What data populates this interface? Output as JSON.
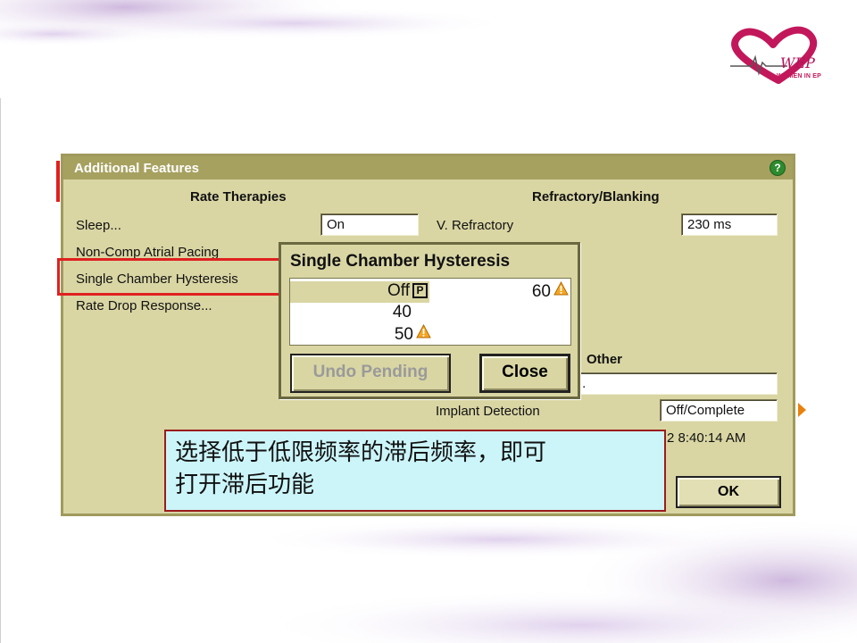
{
  "logo": {
    "caption": "WOMEN IN EP"
  },
  "dialog": {
    "title": "Additional Features",
    "help_label": "?",
    "rate_therapies": {
      "heading": "Rate Therapies",
      "sleep_label": "Sleep...",
      "sleep_value": "On",
      "non_comp_label": "Non-Comp Atrial Pacing",
      "hysteresis_label": "Single Chamber Hysteresis",
      "rate_drop_label": "Rate Drop Response..."
    },
    "refractory": {
      "heading": "Refractory/Blanking",
      "v_refractory_label": "V. Refractory",
      "v_refractory_value": "230 ms"
    },
    "other": {
      "heading": "Other",
      "partial_field_value": "..",
      "implant_detection_label": "Implant Detection",
      "implant_detection_value": "Off/Complete",
      "timestamp_partial": "2 8:40:14 AM"
    },
    "ok_label": "OK"
  },
  "popup": {
    "title": "Single Chamber Hysteresis",
    "options": [
      {
        "value": "Off",
        "badge": "P"
      },
      {
        "value": "60"
      },
      {
        "value": "40"
      },
      {
        "value": "50"
      }
    ],
    "undo_label": "Undo Pending",
    "close_label": "Close"
  },
  "annotation": {
    "text_line1": "选择低于低限频率的滞后频率，即可",
    "text_line2": "打开滞后功能"
  },
  "colors": {
    "dialog_bg": "#d9d6a4",
    "title_bar": "#a7a160",
    "highlight": "#e02020",
    "callout_bg": "#ccf5f9",
    "warning": "#f5a623",
    "brand": "#c2185b"
  }
}
